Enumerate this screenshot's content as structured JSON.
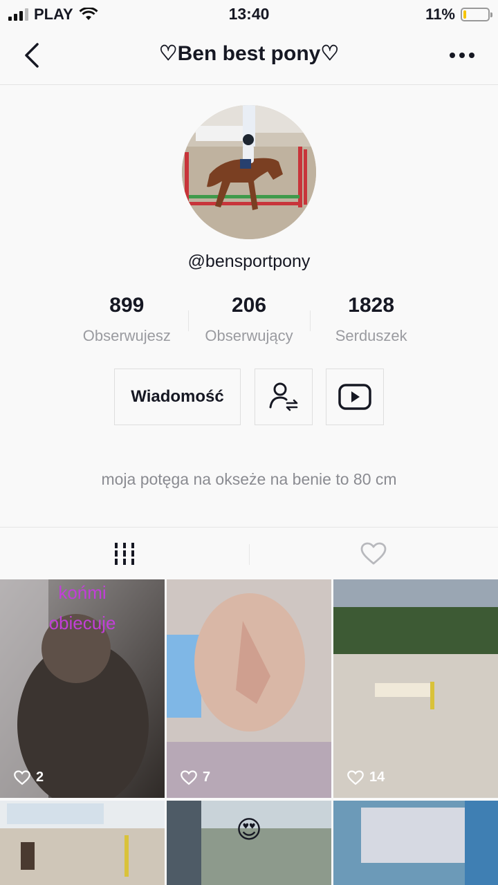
{
  "status": {
    "carrier": "PLAY",
    "time": "13:40",
    "battery": "11%",
    "battery_level": 0.11
  },
  "nav": {
    "title": "♡Ben best pony♡"
  },
  "profile": {
    "username": "@bensportpony",
    "stats": [
      {
        "value": "899",
        "label": "Obserwujesz"
      },
      {
        "value": "206",
        "label": "Obserwujący"
      },
      {
        "value": "1828",
        "label": "Serduszek"
      }
    ],
    "message_button": "Wiadomość",
    "bio": "moja potęga na okseże na benie to 80 cm"
  },
  "videos": [
    {
      "likes": "2",
      "overlay": [
        "końmi",
        "obiecuje"
      ]
    },
    {
      "likes": "7"
    },
    {
      "likes": "14"
    },
    {},
    {
      "emoji": "😍"
    },
    {}
  ]
}
